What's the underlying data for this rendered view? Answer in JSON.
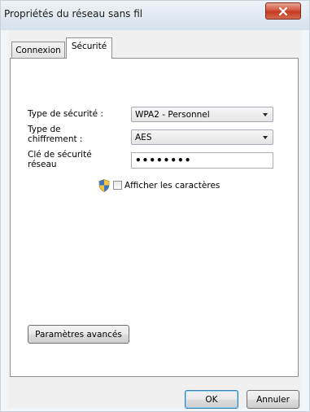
{
  "window": {
    "title": "Propriétés du réseau sans fil",
    "close_glyph": "×"
  },
  "tabs": [
    {
      "label": "Connexion",
      "selected": false
    },
    {
      "label": "Sécurité",
      "selected": true
    }
  ],
  "security": {
    "type_label": "Type de sécurité :",
    "type_value": "WPA2 - Personnel",
    "encryption_label_line1": "Type de",
    "encryption_label_line2": "chiffrement :",
    "encryption_value": "AES",
    "key_label_line1": "Clé de sécurité",
    "key_label_line2": "réseau",
    "key_value": "••••••••",
    "show_chars_label": "Afficher les caractères",
    "show_chars_checked": false,
    "advanced_button": "Paramètres avancés"
  },
  "footer": {
    "ok": "OK",
    "cancel": "Annuler"
  },
  "icons": {
    "close": "close-icon",
    "shield": "uac-shield-icon",
    "dropdown": "chevron-down-icon"
  },
  "colors": {
    "close_button": "#c23a21",
    "ok_focus": "#3c7fb1",
    "panel_bg": "#ffffff",
    "window_bg": "#f0f0f0"
  }
}
